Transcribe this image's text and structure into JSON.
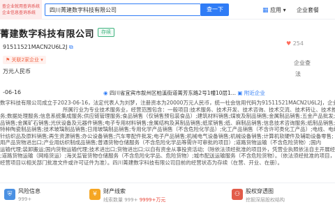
{
  "topbar": {
    "brand_line1": "查企业就用查询系统",
    "brand_line2": "企业信息查询系统",
    "search_value": "四川菁建数字科技有限公司",
    "search_button": "查一下",
    "app_menu": "应用",
    "enterprise_menu": "企业套餐"
  },
  "company": {
    "name": "菁建数字科技有限公司",
    "status": "存续",
    "credit_code": "91511521MACN2U6L2J",
    "follow_count": "254",
    "related_tag": "关联2家企业",
    "assoc_label": "企业查",
    "registered_capital": "万元人民币",
    "corp_label": "法",
    "established": "-06-16",
    "address": "四川省宜宾市叙州区柏溪街道菁芳东路2号1幢10层1...",
    "nearby_link": "附近企业"
  },
  "description": {
    "lines": [
      "数字科技有限公司成立于2023-06-16，法定代表人为刘梦，注册资本为20000万元人民币，统一社会信用代码为91511521MACN2U6L2J，企业地址",
      "所属行业为专业技术服务业，经营范围包含：一般项目:技术服务、技术开发、技术咨询、技术交流、技术转让、技术推广;",
      "务;数据处理服务;信息系统集成服务;供应链管理服务;食品销售（仅销售预包装食品）;建筑材料销售;煤炭及制品销售;金属制品销售;五金产品批发;五金",
      "品销售;金属矿石销售;光伏设备及元器件销售;电子专用材料销售;金属结构及其制品销售;纸浆销售;纸、麻制品销售;信息技术咨询服务;纸制品销售;",
      "特种陶瓷制品销售;技术玻璃制品销售;日用玻璃制品销售;专用化学产品销售（不含危险化学品）;化工产品销售（不含许可类化工产品）;电线、电缆经营;",
      "针纺织品及原料销售;再生资源销售;办公设备销售;汽车零配件批发;电子产品销售;机械电气设备销售;机械设备销售;计算机软硬件及辅助设备零售;",
      "用产品货物进出口;产业用纺织制成品销售;普通货物仓储服务（不含危险化学品等需许可审批的项目）;道路货物运输（不含危险货物）;国内",
      "运输代理;装卸搬运;国内货物运输代理;技术进出口;货物进出口;以自有资金从事投资活动;（除依法须经批准的项目外，凭营业执照依法自主开展经营活动）许可项目",
      ";道路货物运输（网络货运）;海关监管货物仓储服务（不含危险化学品、危险货物）;城市配送运输服务（不含危险货物）。（依法须经批准的项目，",
      "经营项目以相关部门批准文件或许可证件为准）。四川菁建数字科技有限公司目前的经营状态为存续（在营、开业、在册）。"
    ]
  },
  "stats": [
    {
      "label": "风险信息",
      "value": "999+",
      "color": "#4a90e2",
      "icon": "shield-icon"
    },
    {
      "label": "财产线索",
      "value": "线索数量 999+",
      "value_red": "999+",
      "value_unit": "9999+万元",
      "color": "#f5a623",
      "icon": "money-icon"
    },
    {
      "label": "股权穿透图",
      "value": "挖掘深层股权结构",
      "color": "#e25c4a",
      "icon": "chart-icon"
    }
  ]
}
